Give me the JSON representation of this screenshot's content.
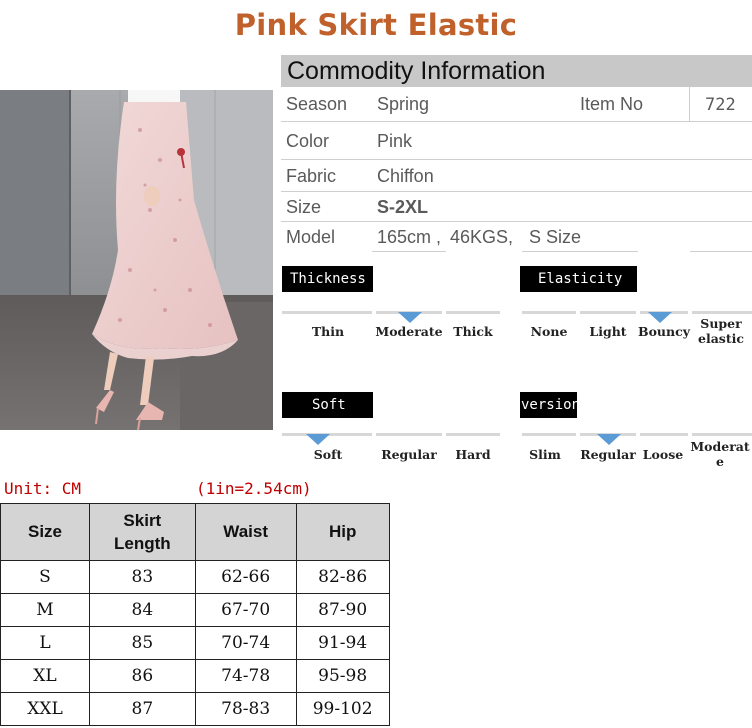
{
  "title": "Pink Skirt Elastic",
  "commodity": {
    "header": "Commodity Information",
    "season_label": "Season",
    "season_value": "Spring",
    "item_no_label": "Item No",
    "item_no_value": "722",
    "color_label": "Color",
    "color_value": "Pink",
    "fabric_label": "Fabric",
    "fabric_value": "Chiffon",
    "size_label": "Size",
    "size_value": "S-2XL",
    "model_label": "Model",
    "model_height": "165cm ,",
    "model_weight": "46KGS,",
    "model_size": "S Size"
  },
  "attributes": {
    "thickness": {
      "label": "Thickness",
      "options": [
        "Thin",
        "Moderate",
        "Thick"
      ],
      "selected": 1
    },
    "elasticity": {
      "label": "Elasticity",
      "options": [
        "None",
        "Light",
        "Bouncy",
        "Super elastic"
      ],
      "selected": 2
    },
    "soft": {
      "label": "Soft",
      "options": [
        "Soft",
        "Regular",
        "Hard"
      ],
      "selected": 0
    },
    "version": {
      "label": "version",
      "options": [
        "Slim",
        "Regular",
        "Loose",
        "Moderate"
      ],
      "selected": 1
    }
  },
  "size_chart": {
    "unit": "Unit: CM",
    "conversion": "(1in=2.54cm)",
    "headers": [
      "Size",
      "Skirt Length",
      "Waist",
      "Hip"
    ],
    "rows": [
      [
        "S",
        "83",
        "62-66",
        "82-86"
      ],
      [
        "M",
        "84",
        "67-70",
        "87-90"
      ],
      [
        "L",
        "85",
        "70-74",
        "91-94"
      ],
      [
        "XL",
        "86",
        "74-78",
        "95-98"
      ],
      [
        "XXL",
        "87",
        "78-83",
        "99-102"
      ]
    ]
  },
  "colors": {
    "title": "#c0602a",
    "marker": "#5b9bd5",
    "unit_text": "#c00000",
    "header_bg": "#c8c8c8"
  }
}
